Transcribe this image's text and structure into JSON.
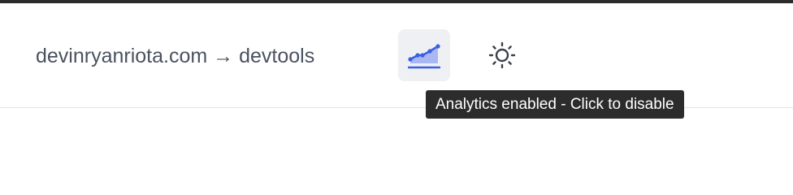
{
  "header": {
    "breadcrumb": {
      "site": "devinryanriota.com",
      "separator": "→",
      "section": "devtools"
    },
    "analytics_toggle": {
      "icon": "chart-line-icon",
      "state": "enabled",
      "tooltip": "Analytics enabled - Click to disable"
    },
    "theme_toggle": {
      "icon": "sun-icon"
    }
  },
  "colors": {
    "breadcrumb_text": "#4a5260",
    "analytics_accent": "#3a5fe0",
    "analytics_fill": "#a9b8f2",
    "button_bg": "#eef0f3",
    "tooltip_bg": "#2c2c2c",
    "divider": "#e3e4e7"
  }
}
